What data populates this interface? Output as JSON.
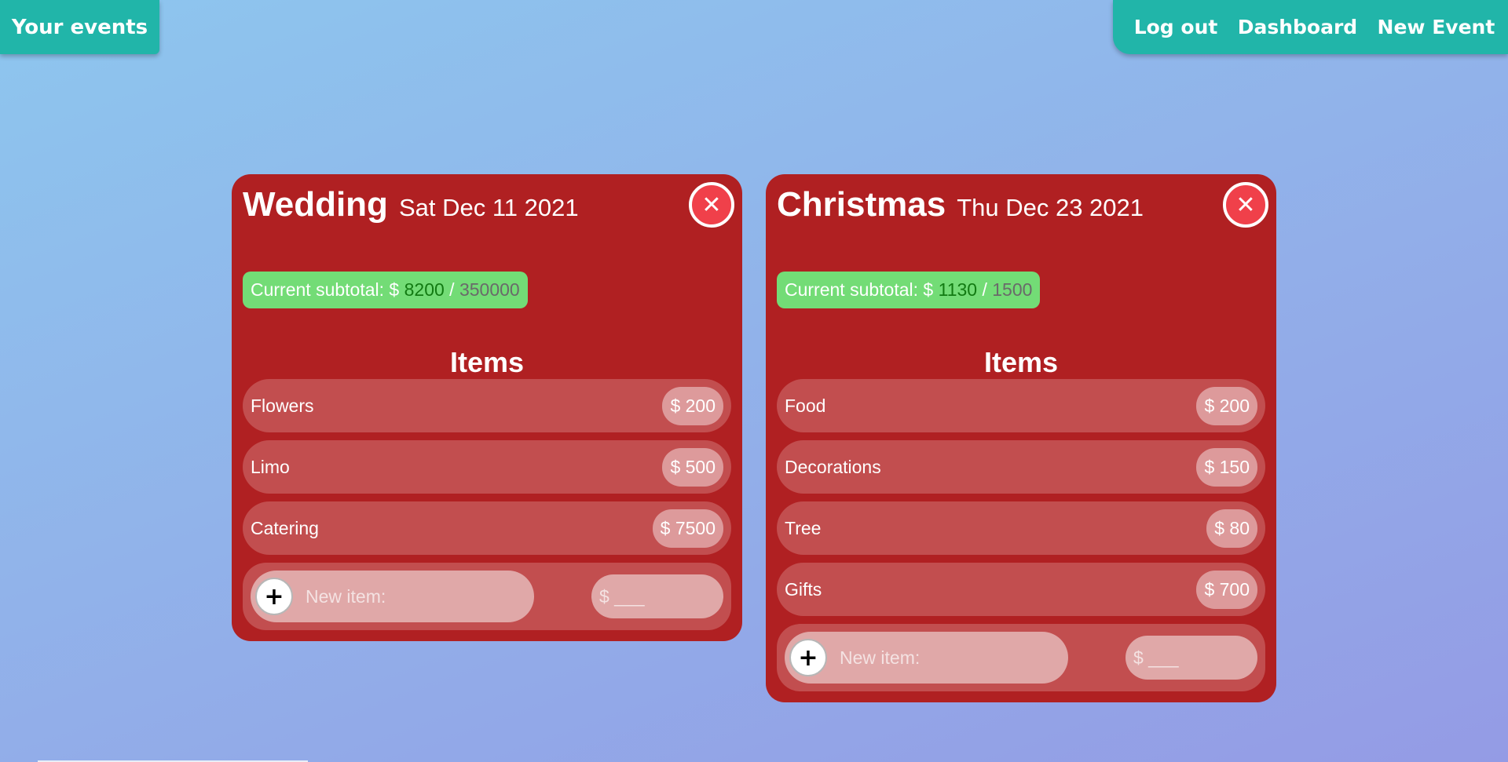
{
  "nav": {
    "brand": "Your events",
    "links": [
      "Log out",
      "Dashboard",
      "New Event"
    ]
  },
  "events": [
    {
      "title": "Wedding",
      "date": "Sat Dec 11 2021",
      "close_icon": "✕",
      "subtotal_label": "Current subtotal: $",
      "subtotal_current": "8200",
      "subtotal_separator": "/",
      "subtotal_budget": "350000",
      "items_heading": "Items",
      "items": [
        {
          "name": "Flowers",
          "price": "$ 200"
        },
        {
          "name": "Limo",
          "price": "$ 500"
        },
        {
          "name": "Catering",
          "price": "$ 7500"
        }
      ],
      "new_item": {
        "add_icon": "+",
        "name_placeholder": "New item:",
        "price_placeholder": "$ ___"
      }
    },
    {
      "title": "Christmas",
      "date": "Thu Dec 23 2021",
      "close_icon": "✕",
      "subtotal_label": "Current subtotal: $",
      "subtotal_current": "1130",
      "subtotal_separator": "/",
      "subtotal_budget": "1500",
      "items_heading": "Items",
      "items": [
        {
          "name": "Food",
          "price": "$ 200"
        },
        {
          "name": "Decorations",
          "price": "$ 150"
        },
        {
          "name": "Tree",
          "price": "$ 80"
        },
        {
          "name": "Gifts",
          "price": "$ 700"
        }
      ],
      "new_item": {
        "add_icon": "+",
        "name_placeholder": "New item:",
        "price_placeholder": "$ ___"
      }
    }
  ],
  "colors": {
    "nav_bg": "#21b5a9",
    "card_bg": "#b02022",
    "close_bg": "#f0404a",
    "subtotal_bg": "#73dc76",
    "item_bg": "#c24e4f",
    "price_pill_bg": "#dd9a9b"
  }
}
